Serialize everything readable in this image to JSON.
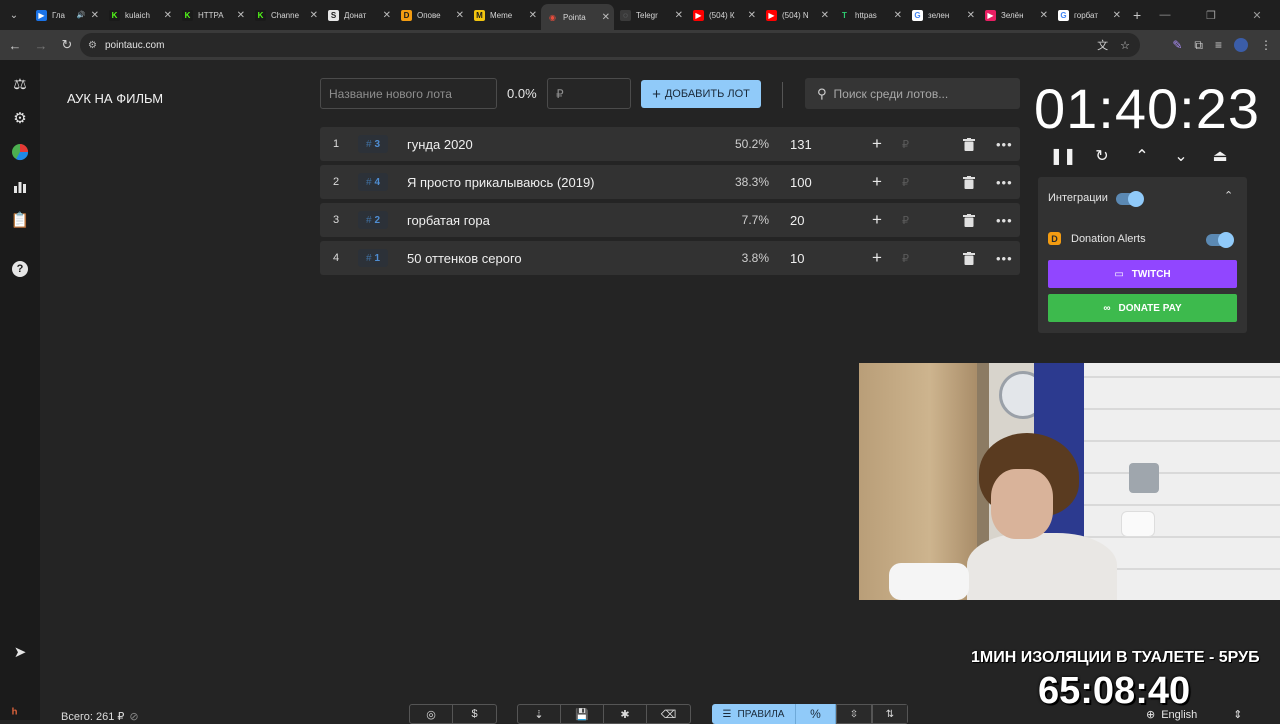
{
  "browser": {
    "tabs": [
      {
        "title": "Гла",
        "fav": "▶",
        "fav_color": "#1a73e8",
        "audio": true
      },
      {
        "title": "kulaich",
        "fav": "K",
        "fav_color": "#1a1a1a",
        "fav_text_color": "#53fc18"
      },
      {
        "title": "HTTPA",
        "fav": "K",
        "fav_color": "#1a1a1a",
        "fav_text_color": "#53fc18"
      },
      {
        "title": "Channe",
        "fav": "K",
        "fav_color": "#1a1a1a",
        "fav_text_color": "#53fc18"
      },
      {
        "title": "Донат",
        "fav": "S",
        "fav_color": "#e6e6e6",
        "fav_text_color": "#1a1a1a"
      },
      {
        "title": "Опове",
        "fav": "D",
        "fav_color": "#f39c12",
        "fav_text_color": "#1a1a1a"
      },
      {
        "title": "Meme",
        "fav": "M",
        "fav_color": "#f1c40f",
        "fav_text_color": "#1a1a1a"
      },
      {
        "title": "Pointa",
        "fav": "◉",
        "fav_color": "#3a3a3a",
        "fav_text_color": "#e74c3c",
        "active": true
      },
      {
        "title": "Telegr",
        "fav": "◌",
        "fav_color": "#3a3a3a",
        "fav_text_color": "#9aa0a6"
      },
      {
        "title": "(504) К",
        "fav": "▶",
        "fav_color": "#ff0000"
      },
      {
        "title": "(504) N",
        "fav": "▶",
        "fav_color": "#ff0000"
      },
      {
        "title": "httpas",
        "fav": "T",
        "fav_color": "#1f1f1f",
        "fav_text_color": "#2ecc71"
      },
      {
        "title": "зелен",
        "fav": "G",
        "fav_color": "#ffffff",
        "fav_text_color": "#4285f4"
      },
      {
        "title": "Зелён",
        "fav": "▶",
        "fav_color": "#e91e63"
      },
      {
        "title": "горбат",
        "fav": "G",
        "fav_color": "#ffffff",
        "fav_text_color": "#4285f4"
      }
    ],
    "url": "pointauc.com"
  },
  "app": {
    "auction_title": "АУК НА ФИЛЬМ",
    "new_lot_placeholder": "Название нового лота",
    "new_lot_percent": "0.0%",
    "amount_placeholder": "₽",
    "add_lot_label": "ДОБАВИТЬ ЛОТ",
    "search_placeholder": "Поиск среди лотов...",
    "currency": "₽",
    "lots": [
      {
        "index": "1",
        "tag": "3",
        "name": "гунда 2020",
        "percent": "50.2%",
        "amount": "131"
      },
      {
        "index": "2",
        "tag": "4",
        "name": "Я просто прикалываюсь (2019)",
        "percent": "38.3%",
        "amount": "100"
      },
      {
        "index": "3",
        "tag": "2",
        "name": "горбатая гора",
        "percent": "7.7%",
        "amount": "20"
      },
      {
        "index": "4",
        "tag": "1",
        "name": "50 оттенков серого",
        "percent": "3.8%",
        "amount": "10"
      }
    ],
    "timer": "01:40:23",
    "integrations": {
      "label": "Интеграции",
      "enabled": true,
      "donation_alerts_label": "Donation Alerts",
      "donation_alerts_enabled": true,
      "twitch_label": "TWITCH",
      "donatepay_label": "DONATE PAY"
    },
    "total": "Всего: 261 ₽",
    "rules_label": "ПРАВИЛА",
    "language": "English"
  },
  "stream_overlay": {
    "caption": "1МИН ИЗОЛЯЦИИ В ТУАЛЕТЕ - 5РУБ",
    "timer": "65:08:40"
  },
  "colors": {
    "accent": "#90caf9",
    "twitch": "#9146ff",
    "donatepay": "#3dba4d",
    "tag_text": "#4f8ed3"
  }
}
